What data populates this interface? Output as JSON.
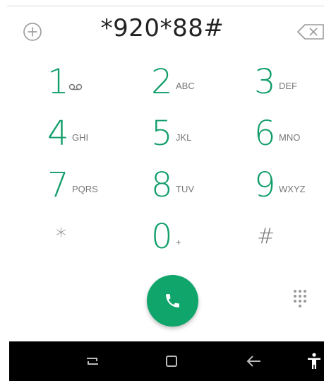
{
  "dialer": {
    "number": "*920*88#"
  },
  "keys": [
    {
      "digit": "1",
      "letters": ""
    },
    {
      "digit": "2",
      "letters": "ABC"
    },
    {
      "digit": "3",
      "letters": "DEF"
    },
    {
      "digit": "4",
      "letters": "GHI"
    },
    {
      "digit": "5",
      "letters": "JKL"
    },
    {
      "digit": "6",
      "letters": "MNO"
    },
    {
      "digit": "7",
      "letters": "PQRS"
    },
    {
      "digit": "8",
      "letters": "TUV"
    },
    {
      "digit": "9",
      "letters": "WXYZ"
    },
    {
      "digit": "*",
      "letters": ""
    },
    {
      "digit": "0",
      "letters": "+"
    },
    {
      "digit": "#",
      "letters": ""
    }
  ],
  "icons": {
    "add_contact": "add-circle-icon",
    "backspace": "backspace-icon",
    "voicemail": "voicemail-icon",
    "call": "phone-icon",
    "dialpad": "dialpad-icon",
    "nav_recents": "recents-icon",
    "nav_home": "home-icon",
    "nav_back": "back-arrow-icon",
    "nav_accessibility": "accessibility-icon"
  },
  "colors": {
    "accent": "#0f9d68",
    "call_button": "#10a56b",
    "navbar": "#000000"
  }
}
